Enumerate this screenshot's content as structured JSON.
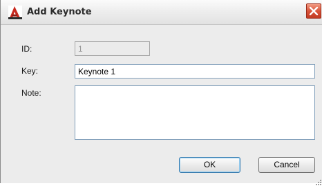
{
  "window": {
    "title": "Add Keynote"
  },
  "form": {
    "id_label": "ID:",
    "id_value": "1",
    "key_label": "Key:",
    "key_value": "Keynote 1",
    "note_label": "Note:",
    "note_value": ""
  },
  "buttons": {
    "ok_label": "OK",
    "cancel_label": "Cancel"
  },
  "icons": {
    "app": "autocad-a-icon",
    "close": "close-icon",
    "resize": "resize-grip-icon"
  },
  "colors": {
    "close_button": "#d9543a",
    "app_icon": "#c8281e"
  }
}
